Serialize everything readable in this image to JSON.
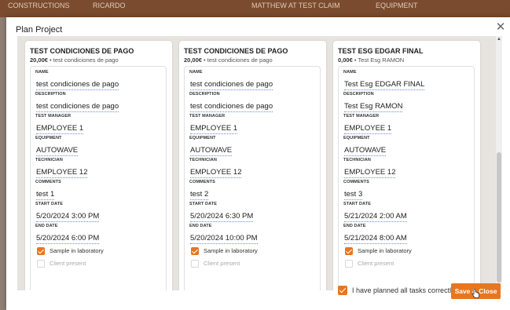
{
  "background": {
    "labels": [
      "CONSTRUCTIONS",
      "RICARDO",
      "MATTHEW AT TEST CLAIM",
      "EQUIPMENT"
    ]
  },
  "dialog": {
    "title": "Plan Project",
    "close_icon": "close-icon"
  },
  "field_labels": {
    "name": "NAME",
    "description": "DESCRIPTION",
    "test_manager": "TEST MANAGER",
    "equipment": "EQUIPMENT",
    "technician": "TECHNICIAN",
    "comments": "COMMENTS",
    "start_date": "START DATE",
    "end_date": "END DATE"
  },
  "cards": [
    {
      "title": "TEST CONDICIONES DE PAGO",
      "price": "20,00€",
      "subtitle": "test condiciones de pago",
      "name": "test condiciones de pago",
      "description": "test condiciones de pago",
      "test_manager": "EMPLOYEE 1",
      "equipment": "AUTOWAVE",
      "technician": "EMPLOYEE 12",
      "comments": "test 1",
      "start_date": "5/20/2024 3:00 PM",
      "end_date": "5/20/2024 6:00 PM",
      "sample_in_lab_label": "Sample in laboratory",
      "sample_in_lab_checked": true,
      "client_present_label": "Client present",
      "client_present_checked": false
    },
    {
      "title": "TEST CONDICIONES DE PAGO",
      "price": "20,00€",
      "subtitle": "test condiciones de pago",
      "name": "test condiciones de pago",
      "description": "test condiciones de pago",
      "test_manager": "EMPLOYEE 1",
      "equipment": "AUTOWAVE",
      "technician": "EMPLOYEE 12",
      "comments": "test 2",
      "start_date": "5/20/2024 6:30 PM",
      "end_date": "5/20/2024 10:00 PM",
      "sample_in_lab_label": "Sample in laboratory",
      "sample_in_lab_checked": true,
      "client_present_label": "Client present",
      "client_present_checked": false
    },
    {
      "title": "TEST ESG EDGAR FINAL",
      "price": "0,00€",
      "subtitle": "Test Esg RAMON",
      "name": "Test Esg EDGAR FINAL",
      "description": "Test Esg RAMON",
      "test_manager": "EMPLOYEE 1",
      "equipment": "AUTOWAVE",
      "technician": "EMPLOYEE 12",
      "comments": "test 3",
      "start_date": "5/21/2024 2:00 AM",
      "end_date": "5/21/2024 8:00 AM",
      "sample_in_lab_label": "Sample in laboratory",
      "sample_in_lab_checked": true,
      "client_present_label": "Client present",
      "client_present_checked": false
    }
  ],
  "footer": {
    "planned_label": "I have planned all tasks correctly",
    "planned_checked": true,
    "save_label": "Save & Close"
  },
  "colors": {
    "accent": "#e8761f",
    "link_underline": "#6b8ec9",
    "panel_bg": "#e7e3df"
  }
}
